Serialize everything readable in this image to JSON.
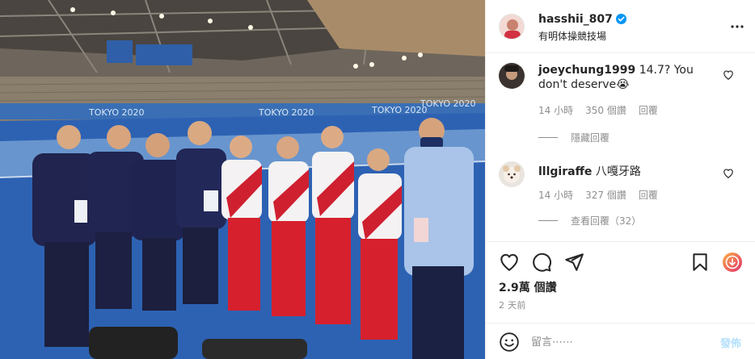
{
  "post": {
    "username": "hasshii_807",
    "location": "有明体操競技場",
    "photo_signage": [
      "TOKYO 2020",
      "TOKYO 2020",
      "TOKYO 2020",
      "TOKYO 2020"
    ]
  },
  "comments": [
    {
      "username": "joeychung1999",
      "text": "14.7? You don't deserve",
      "emoji": "😭",
      "time": "14 小時",
      "likes": "350 個讚",
      "reply_label": "回覆",
      "replies_label": "隱藏回覆"
    },
    {
      "username": "lllgiraffe",
      "text": "八嘎牙路",
      "time": "14 小時",
      "likes": "327 個讚",
      "reply_label": "回覆",
      "replies_label": "查看回覆（32）"
    }
  ],
  "stats": {
    "views": "2.9萬 個讚",
    "posted_ago": "2 天前"
  },
  "compose": {
    "placeholder": "留言⋯⋯",
    "post_label": "發佈"
  },
  "colors": {
    "accent_blue": "#0095f6",
    "post_disabled": "#b2dffc",
    "reel_orange": "#f77737"
  }
}
